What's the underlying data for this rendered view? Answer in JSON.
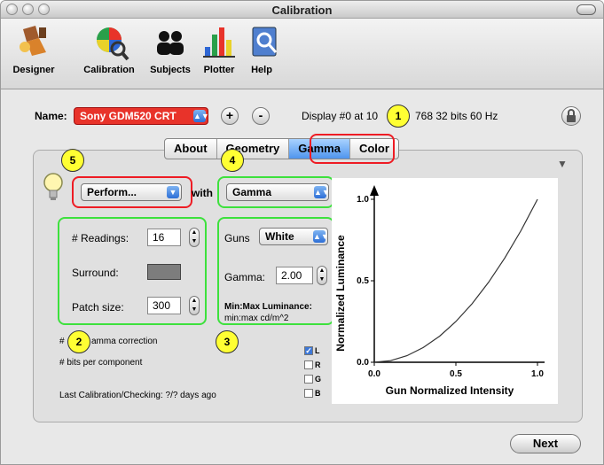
{
  "window": {
    "title": "Calibration"
  },
  "toolbar": {
    "items": [
      {
        "label": "Designer",
        "icon": "designer-icon"
      },
      {
        "label": "Calibration",
        "icon": "calibration-icon"
      },
      {
        "label": "Subjects",
        "icon": "subjects-icon"
      },
      {
        "label": "Plotter",
        "icon": "plotter-icon"
      },
      {
        "label": "Help",
        "icon": "help-icon"
      }
    ]
  },
  "name_bar": {
    "name_label": "Name:",
    "device_value": "Sony GDM520 CRT",
    "add_label": "+",
    "remove_label": "-",
    "display_prefix": "Display #0 at 10",
    "display_suffix": "768  32 bits  60 Hz"
  },
  "tabs": [
    {
      "label": "About",
      "selected": false
    },
    {
      "label": "Geometry",
      "selected": false
    },
    {
      "label": "Gamma",
      "selected": true
    },
    {
      "label": "Color",
      "selected": false
    }
  ],
  "controls": {
    "perform_value": "Perform...",
    "with_label": "with",
    "method_value": "Gamma"
  },
  "readings_group": {
    "readings_label": "# Readings:",
    "readings_value": "16",
    "surround_label": "Surround:",
    "patch_label": "Patch size:",
    "patch_value": "300"
  },
  "gamma_group": {
    "guns_label": "Guns",
    "guns_value": "White",
    "gamma_label": "Gamma:",
    "gamma_value": "2.00",
    "minmax_label": "Min:Max Luminance:",
    "minmax_value": "min:max cd/m^2"
  },
  "info": {
    "gamma_correction": "amma correction",
    "gamma_correction_prefix": "#",
    "bits": "# bits per component",
    "last_calibration": "Last Calibration/Checking: ?/? days ago"
  },
  "checkboxes": [
    {
      "label": "L",
      "checked": true
    },
    {
      "label": "R",
      "checked": false
    },
    {
      "label": "G",
      "checked": false
    },
    {
      "label": "B",
      "checked": false
    }
  ],
  "callouts": [
    "1",
    "2",
    "3",
    "4",
    "5"
  ],
  "chart_data": {
    "type": "line",
    "xlabel": "Gun Normalized Intensity",
    "ylabel": "Normalized Luminance",
    "xlim": [
      0,
      1
    ],
    "ylim": [
      0,
      1
    ],
    "x_ticks": [
      "0.0",
      "0.5",
      "1.0"
    ],
    "y_ticks": [
      "0.0",
      "0.5",
      "1.0"
    ],
    "gamma": 2.0,
    "x": [
      0.0,
      0.1,
      0.2,
      0.3,
      0.4,
      0.5,
      0.6,
      0.7,
      0.8,
      0.9,
      1.0
    ],
    "y": [
      0.0,
      0.01,
      0.04,
      0.09,
      0.16,
      0.25,
      0.36,
      0.49,
      0.64,
      0.81,
      1.0
    ]
  },
  "buttons": {
    "next_label": "Next"
  },
  "colors": {
    "accent": "#4f95ee",
    "callout_fill": "#ffff33",
    "highlight_red": "#ee1c24",
    "highlight_green": "#3de13d"
  }
}
